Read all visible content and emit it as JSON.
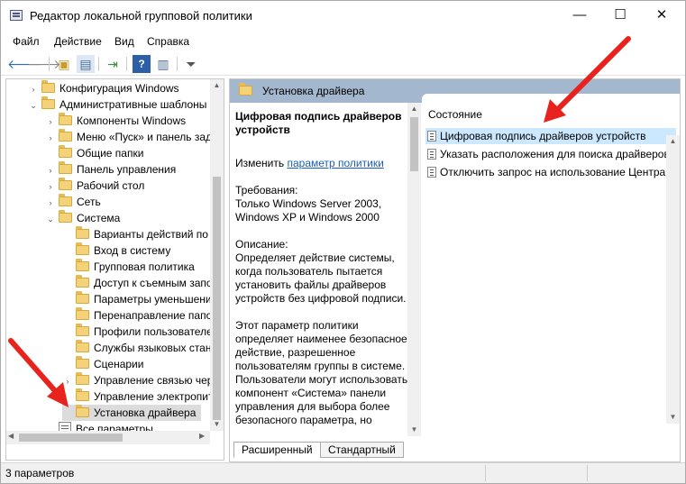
{
  "window": {
    "title": "Редактор локальной групповой политики",
    "minimize": "—",
    "maximize": "☐",
    "close": "✕"
  },
  "menu": [
    "Файл",
    "Действие",
    "Вид",
    "Справка"
  ],
  "toolbar": {
    "icons": [
      "back-icon",
      "forward-icon",
      "up-folder-icon",
      "show-hide-tree-icon",
      "export-list-icon",
      "help-icon",
      "properties-icon",
      "filter-icon"
    ]
  },
  "tree": [
    {
      "label": "Конфигурация Windows",
      "level": 1,
      "expander": "›",
      "icon": "folder"
    },
    {
      "label": "Административные шаблоны",
      "level": 1,
      "expander": "⌄",
      "icon": "folder"
    },
    {
      "label": "Компоненты Windows",
      "level": 2,
      "expander": "›",
      "icon": "folder"
    },
    {
      "label": "Меню «Пуск» и панель задач",
      "level": 2,
      "expander": "›",
      "icon": "folder"
    },
    {
      "label": "Общие папки",
      "level": 2,
      "expander": "",
      "icon": "folder"
    },
    {
      "label": "Панель управления",
      "level": 2,
      "expander": "›",
      "icon": "folder"
    },
    {
      "label": "Рабочий стол",
      "level": 2,
      "expander": "›",
      "icon": "folder"
    },
    {
      "label": "Сеть",
      "level": 2,
      "expander": "›",
      "icon": "folder"
    },
    {
      "label": "Система",
      "level": 2,
      "expander": "⌄",
      "icon": "folder"
    },
    {
      "label": "Варианты действий по",
      "level": 3,
      "expander": "",
      "icon": "folder"
    },
    {
      "label": "Вход в систему",
      "level": 3,
      "expander": "",
      "icon": "folder"
    },
    {
      "label": "Групповая политика",
      "level": 3,
      "expander": "",
      "icon": "folder"
    },
    {
      "label": "Доступ к съемным запоминающим",
      "level": 3,
      "expander": "",
      "icon": "folder"
    },
    {
      "label": "Параметры уменьшения",
      "level": 3,
      "expander": "",
      "icon": "folder"
    },
    {
      "label": "Перенаправление папок",
      "level": 3,
      "expander": "",
      "icon": "folder"
    },
    {
      "label": "Профили пользователей",
      "level": 3,
      "expander": "",
      "icon": "folder"
    },
    {
      "label": "Службы языковых стандартов",
      "level": 3,
      "expander": "",
      "icon": "folder"
    },
    {
      "label": "Сценарии",
      "level": 3,
      "expander": "",
      "icon": "folder"
    },
    {
      "label": "Управление связью через",
      "level": 3,
      "expander": "›",
      "icon": "folder"
    },
    {
      "label": "Управление электропитанием",
      "level": 3,
      "expander": "",
      "icon": "folder"
    },
    {
      "label": "Установка драйвера",
      "level": 3,
      "expander": "",
      "icon": "folder",
      "selected": true
    },
    {
      "label": "Все параметры",
      "level": 2,
      "expander": "",
      "icon": "settings"
    }
  ],
  "right_header": "Установка драйвера",
  "description": {
    "title": "Цифровая подпись драйверов устройств",
    "edit_prefix": "Изменить ",
    "edit_link": "параметр политики",
    "requirements": "Требования:\nТолько Windows Server 2003, Windows XP и Windows 2000",
    "description": "Описание:\nОпределяет действие системы, когда пользователь пытается установить файлы драйверов устройств без цифровой подписи.",
    "body": "Этот параметр политики определяет наименее безопасное действие, разрешенное пользователям группы в системе. Пользователи могут использовать компонент «Система» панели управления для выбора более безопасного параметра, но"
  },
  "list": {
    "column_header": "Состояние",
    "items": [
      {
        "label": "Цифровая подпись драйверов устройств",
        "selected": true
      },
      {
        "label": "Указать расположения для поиска драйверов",
        "selected": false
      },
      {
        "label": "Отключить запрос на использование Центра обновления Windows",
        "selected": false
      }
    ]
  },
  "tabs": {
    "extended": "Расширенный",
    "standard": "Стандартный"
  },
  "status": {
    "text": "3 параметров"
  },
  "colors": {
    "header_bg": "#a3b7ce",
    "selection": "#cce8ff",
    "annotation_arrow": "#e8231d"
  }
}
